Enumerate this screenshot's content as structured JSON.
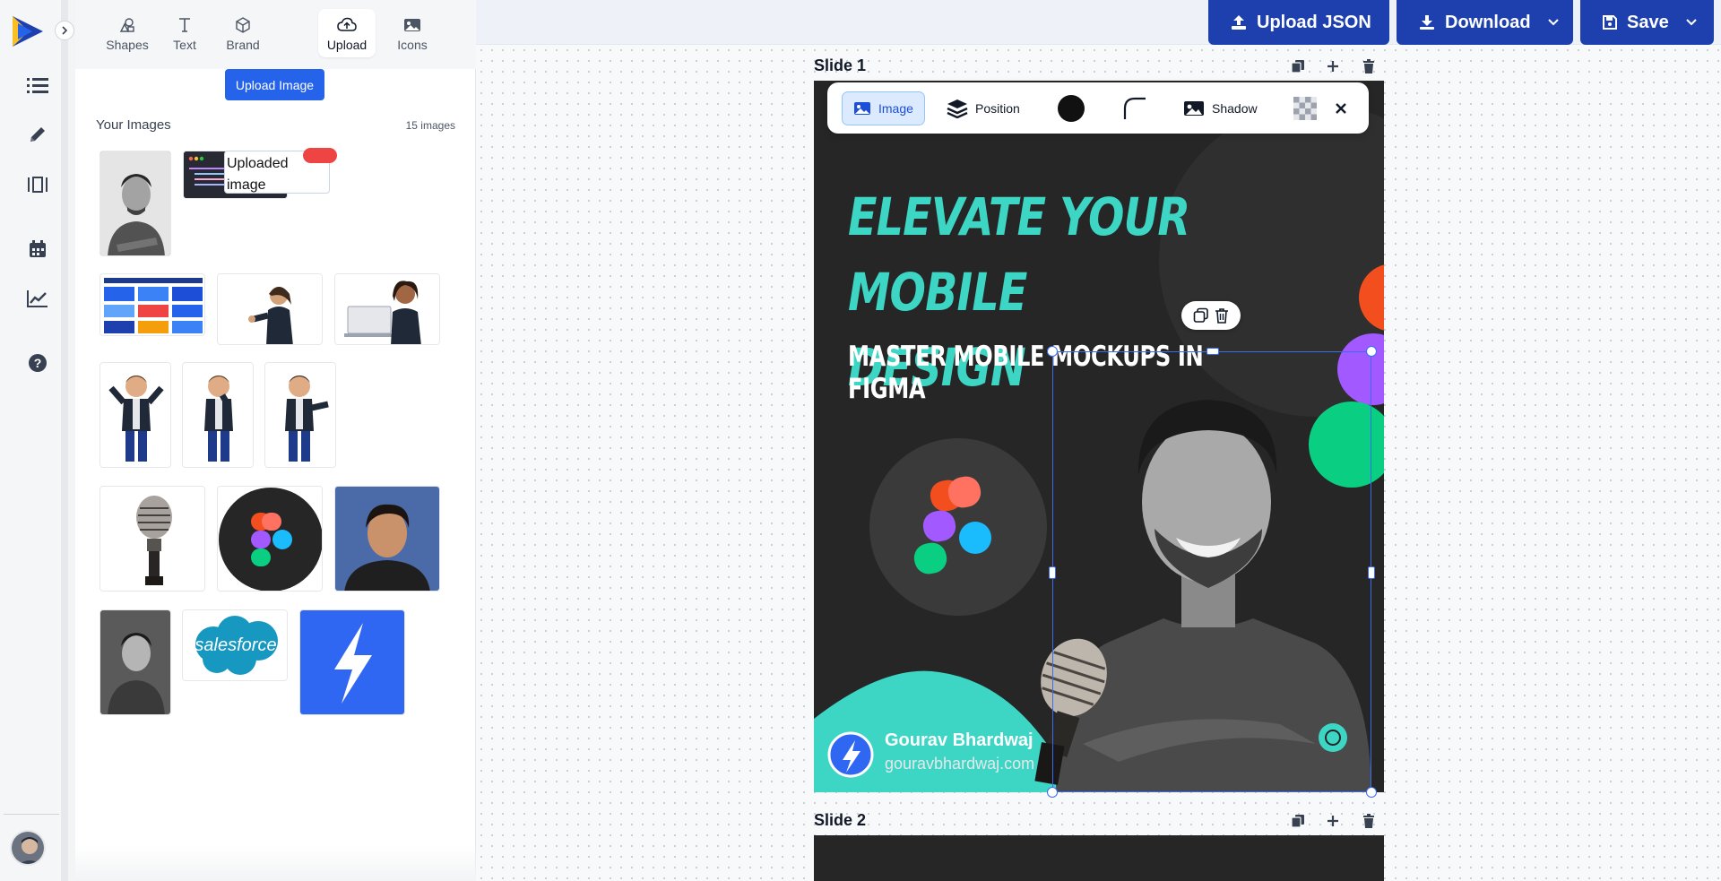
{
  "rail": {
    "items": [
      "list",
      "pen",
      "columns",
      "calendar",
      "analytics",
      "help"
    ]
  },
  "panel": {
    "tabs": [
      {
        "label": "Shapes",
        "icon": "shapes-icon"
      },
      {
        "label": "Text",
        "icon": "text-icon"
      },
      {
        "label": "Brand",
        "icon": "cube-icon"
      },
      {
        "label": "Upload",
        "icon": "cloud-upload-icon",
        "active": true
      },
      {
        "label": "Icons",
        "icon": "image-icon"
      }
    ],
    "upload_button": "Upload Image",
    "your_images": "Your Images",
    "image_count": "15 images",
    "broken_image_alt": "Uploaded image",
    "code_thumb_lines": [
      "CreateDirectoryIfMissing(",
      "  isDirectory,",
      "  preserveRelativityForImports,",
      "  preserveDirectoryCreated)"
    ]
  },
  "topbar": {
    "upload_json": "Upload JSON",
    "download": "Download",
    "save": "Save"
  },
  "slides": [
    {
      "label": "Slide 1"
    },
    {
      "label": "Slide 2"
    }
  ],
  "toolbar": {
    "image": "Image",
    "position": "Position",
    "shadow": "Shadow"
  },
  "slide_content": {
    "headline_line1": "ELEVATE YOUR MOBILE",
    "headline_line2": "DESIGN",
    "subhead": "MASTER MOBILE MOCKUPS IN FIGMA",
    "author_name": "Gourav Bhardwaj",
    "author_site": "gouravbhardwaj.com"
  },
  "colors": {
    "primary_button": "#1e40af",
    "accent_teal": "#3dd6c4",
    "slide_bg": "#262626",
    "figma_red": "#f24e1e",
    "figma_purple": "#a259ff",
    "figma_green": "#0acf83",
    "figma_blue": "#1abcfe",
    "selection": "#3b6cf0"
  }
}
